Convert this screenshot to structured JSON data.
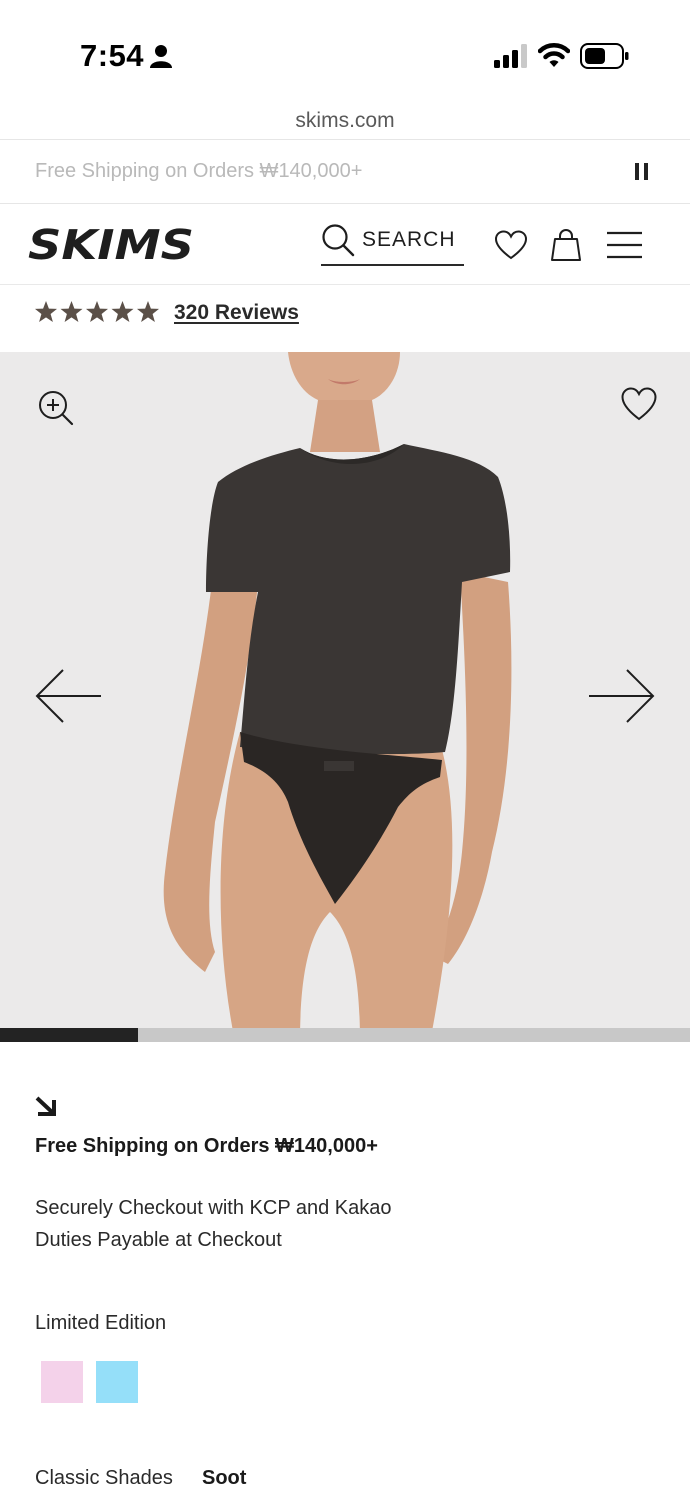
{
  "status_bar": {
    "time": "7:54",
    "icons": [
      "person-icon",
      "cellular-signal-icon",
      "wifi-icon",
      "battery-icon"
    ]
  },
  "browser": {
    "url": "skims.com"
  },
  "announcement": {
    "text": "Free Shipping on Orders ₩140,000+",
    "control_icon": "pause-icon"
  },
  "header": {
    "logo_text": "SKIMS",
    "search_label": "SEARCH",
    "icons": [
      "search-icon",
      "heart-icon",
      "bag-icon",
      "menu-icon"
    ]
  },
  "rating": {
    "stars": 5,
    "reviews_label": "320 Reviews"
  },
  "gallery": {
    "icons": [
      "zoom-in-icon",
      "heart-icon",
      "arrow-left-icon",
      "arrow-right-icon"
    ],
    "progress_fraction": 0.2
  },
  "promo": {
    "icon": "arrow-down-right-icon",
    "title": "Free Shipping on Orders ₩140,000+",
    "line1": "Securely Checkout with KCP and Kakao",
    "line2": "Duties Payable at Checkout"
  },
  "limited_edition": {
    "label": "Limited Edition",
    "swatches": [
      {
        "name": "pink",
        "color": "#f4d2ea"
      },
      {
        "name": "blue",
        "color": "#95dff9"
      }
    ]
  },
  "classic_shades": {
    "label": "Classic Shades",
    "selected": "Soot"
  },
  "colors": {
    "accent_dark": "#232323",
    "star": "#5b5048",
    "gallery_bg": "#ebeaea"
  }
}
